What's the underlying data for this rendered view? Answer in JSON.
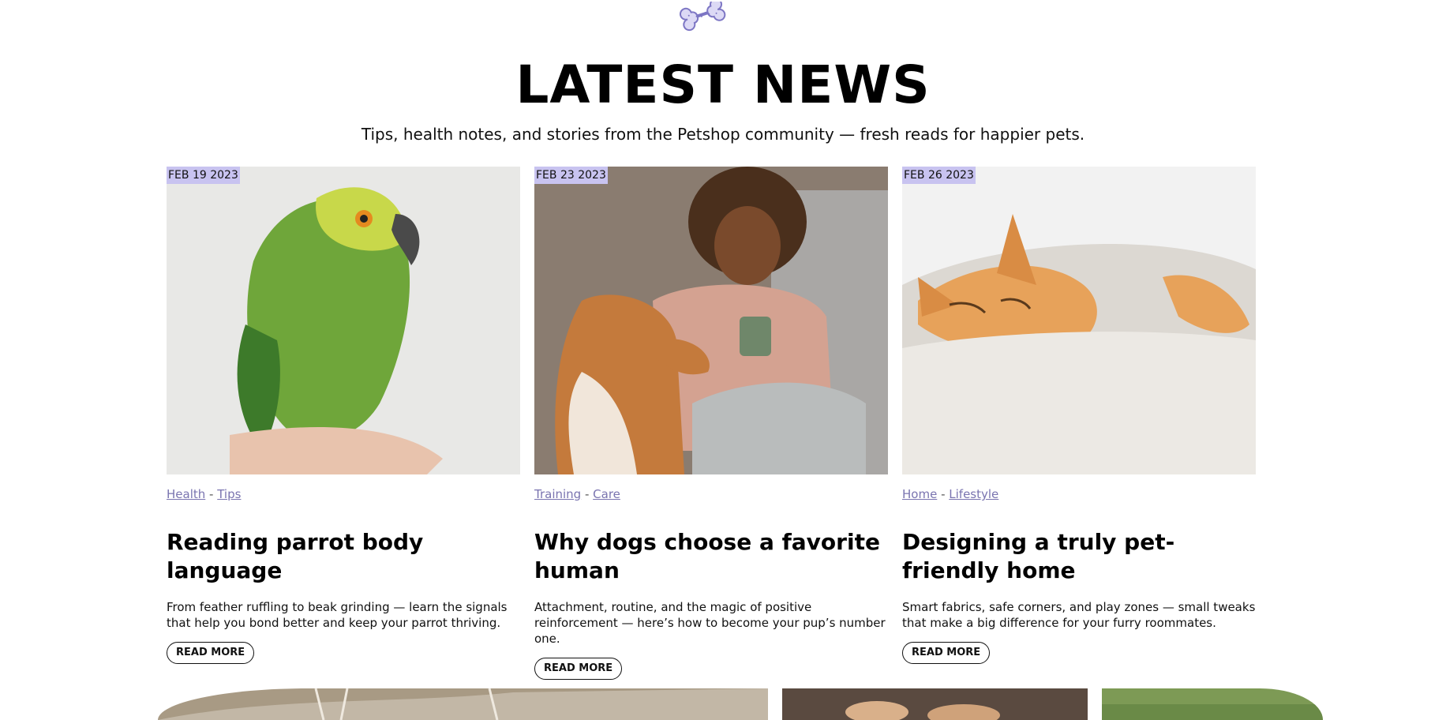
{
  "header": {
    "icon": "bone-icon",
    "title": "LATEST NEWS",
    "subtitle": "Tips, health notes, and stories from the Petshop community — fresh reads for happier pets."
  },
  "colors": {
    "accent": "#c8c3f0",
    "link": "#7a74b0",
    "text": "#111111"
  },
  "posts": [
    {
      "date": "FEB 19 2023",
      "tags": [
        "Health",
        "Tips"
      ],
      "title": "Reading parrot body language",
      "excerpt": "From feather ruffling to beak grinding — learn the signals that help you bond better and keep your parrot thriving.",
      "button": "READ MORE"
    },
    {
      "date": "FEB 23 2023",
      "tags": [
        "Training",
        "Care"
      ],
      "title": "Why dogs choose a favorite human",
      "excerpt": "Attachment, routine, and the magic of positive reinforcement — here’s how to become your pup’s number one.",
      "button": "READ MORE"
    },
    {
      "date": "FEB 26 2023",
      "tags": [
        "Home",
        "Lifestyle"
      ],
      "title": "Designing a truly pet-friendly home",
      "excerpt": "Smart fabrics, safe corners, and play zones — small tweaks that make a big difference for your furry roommates.",
      "button": "READ MORE"
    }
  ]
}
